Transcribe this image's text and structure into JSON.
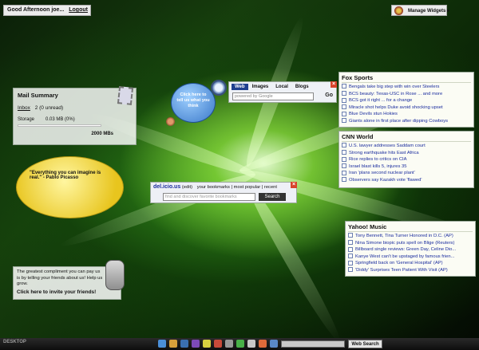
{
  "greeting": {
    "text": "Good Afternoon joe...",
    "logout": "Logout"
  },
  "manage_widgets": {
    "label": "Manage Widgets"
  },
  "mail": {
    "title": "Mail Summary",
    "inbox_label": "Inbox",
    "inbox_count": "2 (0 unread)",
    "storage_label": "Storage",
    "storage_used": "0.03 MB (0%)",
    "storage_capacity": "2000 MBs",
    "storage_fraction": 0.0
  },
  "help_bubble": {
    "text": "Click here to tell us what you think"
  },
  "web_search": {
    "tabs": [
      "Web",
      "Images",
      "Local",
      "Blogs"
    ],
    "active_tab": "Web",
    "placeholder": "powered by Google",
    "go": "Go"
  },
  "fox_sports": {
    "title": "Fox Sports",
    "items": [
      "Bengals take big step with win over Steelers",
      "BCS beauty: Texas-USC in Rose ... and more",
      "BCS got it right ... for a change",
      "Miracle shot helps Duke avoid shocking upset",
      "Blue Devils stun Hokies",
      "Giants alone in first place after dipping Cowboys"
    ]
  },
  "cnn_world": {
    "title": "CNN World",
    "items": [
      "U.S. lawyer addresses Saddam court",
      "Strong earthquake hits East Africa",
      "Rice replies to critics on CIA",
      "Israel blast kills 5, injures 35",
      "Iran 'plans second nuclear plant'",
      "Observers say Kazakh vote 'flawed'"
    ]
  },
  "quote": {
    "text": "\"Everything you can imagine is real.\" - Pablo Picasso"
  },
  "delicious": {
    "brand": "del.icio.us",
    "edit": "(edit)",
    "links": "your bookmarks | most popular | recent",
    "placeholder": "find and discover favorite bookmarks",
    "search": "Search"
  },
  "yahoo_music": {
    "title": "Yahoo! Music",
    "items": [
      "Tony Bennett, Tina Turner Honored in D.C. (AP)",
      "Nina Simone biopic puts spell on Blige (Reuters)",
      "Billboard single reviews: Green Day, Celine Dio...",
      "Kanye West can't be upstaged by famous frien...",
      "Springfield back on 'General Hospital' (AP)",
      "'Diddy' Surprises Teen Patient With Visit (AP)"
    ]
  },
  "invite": {
    "text": "The greatest compliment you can pay us is by telling your friends about us! Help us grow.",
    "cta": "Click here to invite your friends!"
  },
  "taskbar": {
    "logo": "DESKTOP",
    "search_button": "Web Search",
    "icons": [
      "globe-icon",
      "calculator-icon",
      "mail-icon",
      "music-icon",
      "notes-icon",
      "calendar-icon",
      "wrench-icon",
      "chat-icon",
      "news-icon",
      "photo-icon",
      "bookmark-icon"
    ],
    "icon_colors": [
      "#4a8fd8",
      "#d8a03a",
      "#3a6fb0",
      "#7d4ab8",
      "#d8d040",
      "#c84a3a",
      "#9a9a9a",
      "#48b048",
      "#c8c8c8",
      "#e06a3a",
      "#5a88c8"
    ]
  }
}
